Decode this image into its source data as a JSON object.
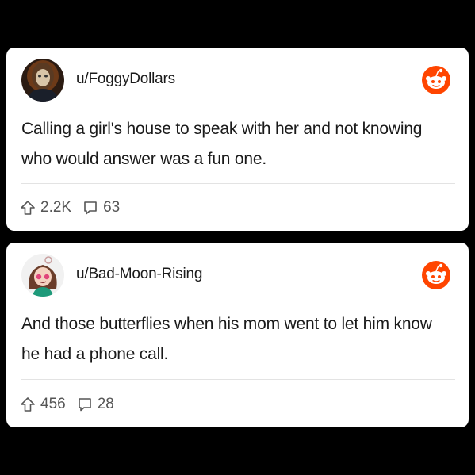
{
  "posts": [
    {
      "username": "u/FoggyDollars",
      "text": "Calling a girl's house to speak with her and not knowing who would answer was a fun one.",
      "upvotes": "2.2K",
      "comments": "63",
      "avatar_icon": "masked-figure-avatar"
    },
    {
      "username": "u/Bad-Moon-Rising",
      "text": "And those butterflies when his mom went to let him know he had a phone call.",
      "upvotes": "456",
      "comments": "28",
      "avatar_icon": "cartoon-girl-avatar"
    }
  ],
  "colors": {
    "background": "#000000",
    "card": "#ffffff",
    "reddit_orange": "#ff4500",
    "text": "#1a1a1a",
    "meta": "#555555"
  }
}
